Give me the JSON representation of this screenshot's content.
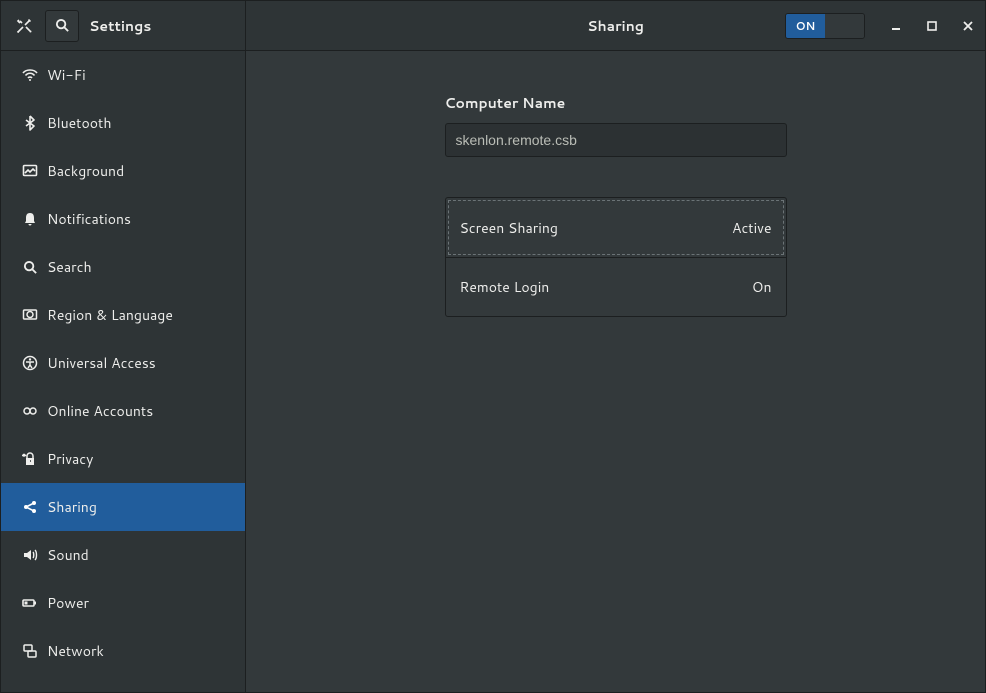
{
  "app": {
    "title": "Settings"
  },
  "header": {
    "panel_title": "Sharing",
    "switch_label": "ON"
  },
  "sidebar": {
    "items": [
      {
        "id": "wifi",
        "label": "Wi-Fi"
      },
      {
        "id": "bluetooth",
        "label": "Bluetooth"
      },
      {
        "id": "background",
        "label": "Background"
      },
      {
        "id": "notifications",
        "label": "Notifications"
      },
      {
        "id": "search",
        "label": "Search"
      },
      {
        "id": "region",
        "label": "Region & Language"
      },
      {
        "id": "universal",
        "label": "Universal Access"
      },
      {
        "id": "online",
        "label": "Online Accounts"
      },
      {
        "id": "privacy",
        "label": "Privacy"
      },
      {
        "id": "sharing",
        "label": "Sharing",
        "active": true
      },
      {
        "id": "sound",
        "label": "Sound"
      },
      {
        "id": "power",
        "label": "Power"
      },
      {
        "id": "network",
        "label": "Network"
      }
    ]
  },
  "main": {
    "computer_name_label": "Computer Name",
    "computer_name_value": "skenlon.remote.csb",
    "rows": [
      {
        "label": "Screen Sharing",
        "value": "Active"
      },
      {
        "label": "Remote Login",
        "value": "On"
      }
    ]
  }
}
